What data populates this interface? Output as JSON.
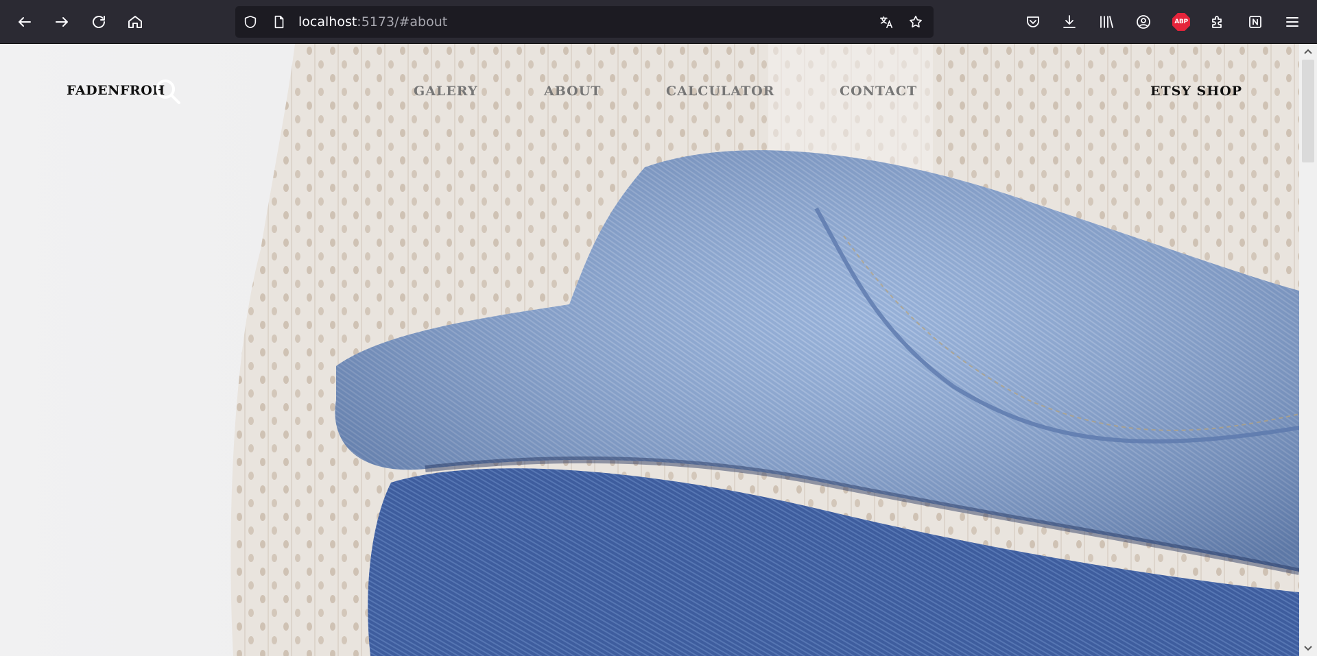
{
  "browser": {
    "url_host": "localhost",
    "url_rest": ":5173/#about",
    "icons": {
      "back": "arrow-left-icon",
      "forward": "arrow-right-icon",
      "reload": "reload-icon",
      "home": "home-icon",
      "shield": "tracking-shield-icon",
      "page": "page-info-icon",
      "translate": "translate-icon",
      "bookmark": "star-icon",
      "pocket": "pocket-icon",
      "downloads": "download-icon",
      "library": "library-icon",
      "account": "account-icon",
      "extensions": "puzzle-icon",
      "notion": "notion-icon",
      "menu": "hamburger-menu-icon"
    },
    "abp_label": "ABP"
  },
  "site": {
    "brand": "FADENFROH",
    "nav": {
      "galery": "GALERY",
      "about": "ABOUT",
      "calculator": "CALCULATOR",
      "contact": "CONTACT"
    },
    "shop": "ETSY SHOP"
  },
  "colors": {
    "chrome_bg": "#2b2a33",
    "urlbar_bg": "#1c1b22",
    "nav_link": "#767676",
    "brand_text": "#111111",
    "abp_red": "#e5243b"
  }
}
